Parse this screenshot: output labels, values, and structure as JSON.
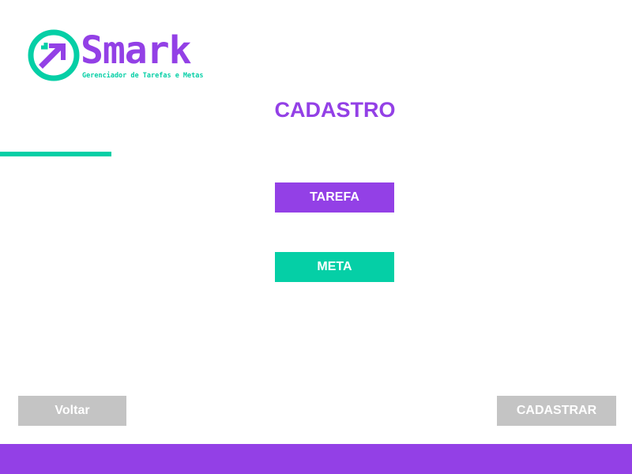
{
  "brand": {
    "name": "Smark",
    "tagline": "Gerenciador de Tarefas e Metas",
    "logo_icon": "arrow-up-right-circle-icon"
  },
  "page": {
    "title": "CADASTRO"
  },
  "options": {
    "tarefa_label": "TAREFA",
    "meta_label": "META"
  },
  "actions": {
    "back_label": "Voltar",
    "submit_label": "CADASTRAR"
  },
  "colors": {
    "primary": "#9340e6",
    "accent": "#05cfa6",
    "disabled": "#c4c4c4",
    "background": "#ffffff"
  }
}
